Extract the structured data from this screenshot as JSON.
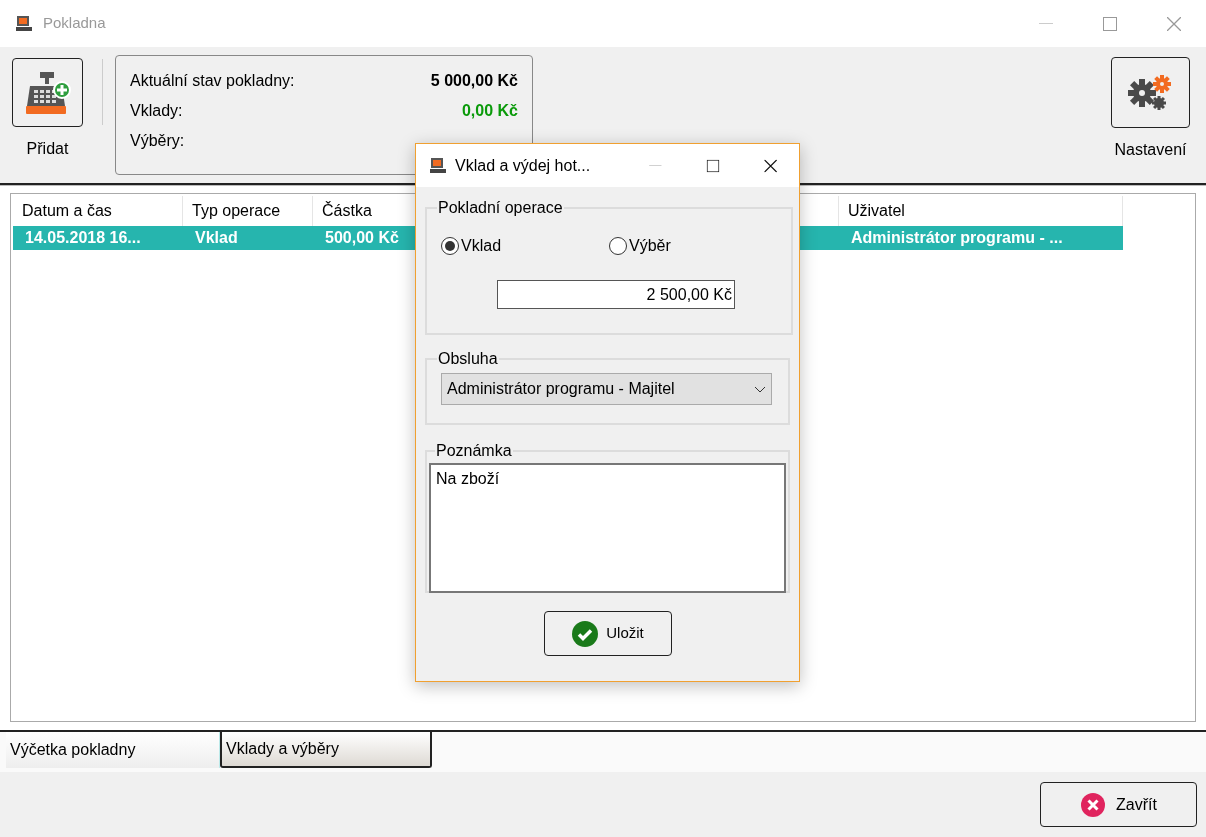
{
  "window": {
    "title": "Pokladna"
  },
  "toolbar": {
    "add_button": {
      "label": "Přidat"
    },
    "settings_button": {
      "label": "Nastavení"
    },
    "summary": [
      {
        "label": "Aktuální stav pokladny:",
        "value": "5 000,00 Kč",
        "kind": "total"
      },
      {
        "label": "Vklady:",
        "value": "0,00 Kč",
        "kind": "deposit"
      },
      {
        "label": "Výběry:"
      }
    ]
  },
  "table": {
    "columns": [
      "Datum a čas",
      "Typ operace",
      "Částka",
      "Uživatel"
    ],
    "rows": [
      {
        "cells": [
          "14.05.2018 16...",
          "Vklad",
          "500,00 Kč",
          "Administrátor programu - ..."
        ],
        "selected": true
      }
    ]
  },
  "tabs": [
    {
      "label": "Výčetka pokladny",
      "selected": false
    },
    {
      "label": "Vklady a výběry",
      "selected": true
    }
  ],
  "close_button": {
    "label": "Zavřít"
  },
  "dialog": {
    "title": "Vklad a výdej hot...",
    "operation_group": {
      "legend": "Pokladní operace",
      "options": [
        {
          "label": "Vklad",
          "selected": true
        },
        {
          "label": "Výběr",
          "selected": false
        }
      ],
      "amount": "2 500,00 Kč"
    },
    "staff_group": {
      "legend": "Obsluha",
      "value": "Administrátor programu - Majitel"
    },
    "note_group": {
      "legend": "Poznámka",
      "value": "Na zboží"
    },
    "save_button": {
      "label": "Uložit"
    }
  }
}
